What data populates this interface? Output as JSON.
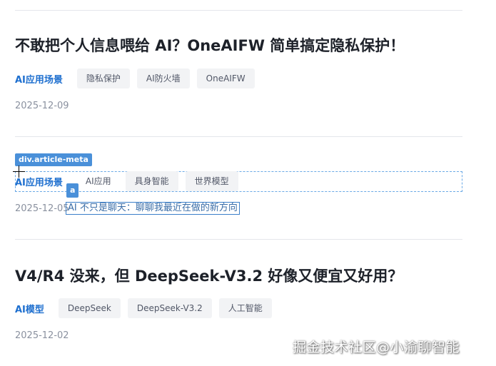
{
  "articles": [
    {
      "title": "不敢把个人信息喂给 AI？OneAIFW 简单搞定隐私保护！",
      "category": "AI应用场景",
      "tags": [
        "隐私保护",
        "AI防火墙",
        "OneAIFW"
      ],
      "date": "2025-12-09"
    },
    {
      "title": "AI 不只是聊天：聊聊我最近在做的新方向",
      "category": "AI应用场景",
      "tags": [
        "AI应用",
        "具身智能",
        "世界模型"
      ],
      "date": "2025-12-05"
    },
    {
      "title": "V4/R4 没来，但 DeepSeek-V3.2 好像又便宜又好用？",
      "category": "AI模型",
      "tags": [
        "DeepSeek",
        "DeepSeek-V3.2",
        "人工智能"
      ],
      "date": "2025-12-02"
    }
  ],
  "inspector": {
    "meta_label": "div.article-meta",
    "link_label": "a"
  },
  "watermark": "掘金技术社区@小渝聊智能"
}
